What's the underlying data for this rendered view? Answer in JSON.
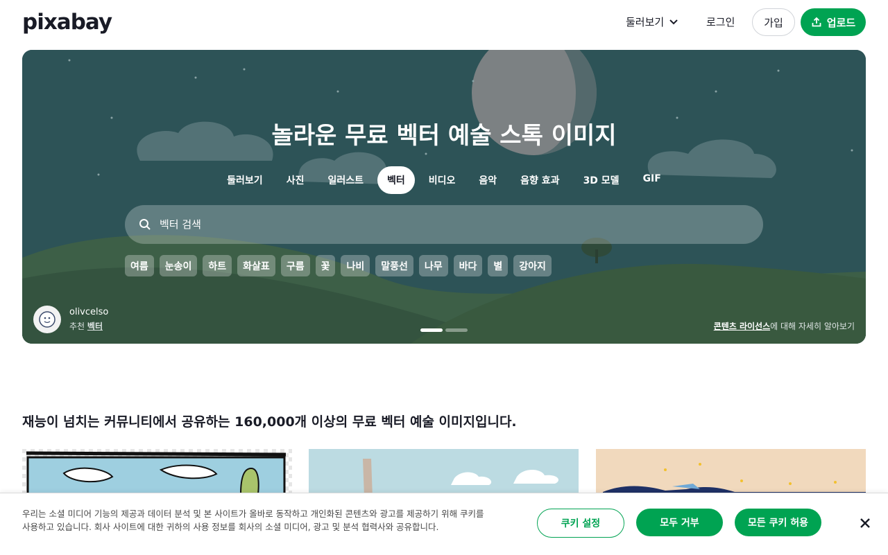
{
  "header": {
    "logo": "pixabay",
    "explore": "둘러보기",
    "login": "로그인",
    "join": "가입",
    "upload": "업로드"
  },
  "hero": {
    "title": "놀라운 무료 벡터 예술 스톡 이미지",
    "categories": [
      "둘러보기",
      "사진",
      "일러스트",
      "벡터",
      "비디오",
      "음악",
      "음향 효과",
      "3D 모델",
      "GIF"
    ],
    "active_category": "벡터",
    "search_placeholder": "벡터 검색",
    "tags": [
      "여름",
      "눈송이",
      "하트",
      "화살표",
      "구름",
      "꽃",
      "나비",
      "말풍선",
      "나무",
      "바다",
      "별",
      "강아지"
    ],
    "credit": {
      "user": "olivcelso",
      "label": "추천",
      "link": "벡터"
    },
    "license_link": "콘텐츠 라이선스",
    "license_rest": "에 대해 자세히 알아보기",
    "slides_active": 1,
    "slides_total": 2
  },
  "section_title": "재능이 넘치는 커뮤니티에서 공유하는 160,000개 이상의 무료 벡터 예술 이미지입니다.",
  "cookie": {
    "text": "우리는 소셜 미디어 기능의 제공과 데이터 분석 및 본 사이트가 올바로 동작하고 개인화된 콘텐츠와 광고를 제공하기 위해 쿠키를 사용하고 있습니다. 회사 사이트에 대한 귀하의 사용 정보를 회사의 소셜 미디어, 광고 및 분석 협력사와 공유합니다.",
    "settings": "쿠키 설정",
    "reject": "모두 거부",
    "accept": "모든 쿠키 허용"
  },
  "colors": {
    "brand": "#00a352",
    "hero_bg": "#2e5458"
  }
}
